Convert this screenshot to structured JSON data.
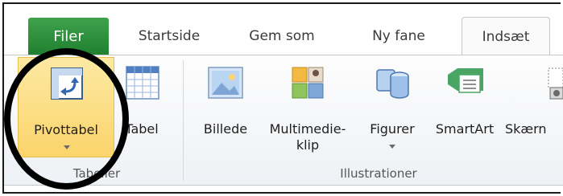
{
  "tabs": [
    {
      "label": "Filer"
    },
    {
      "label": "Startside"
    },
    {
      "label": "Gem som"
    },
    {
      "label": "Ny fane"
    },
    {
      "label": "Indsæt"
    }
  ],
  "ribbon": {
    "buttons": {
      "pivottabel": "Pivottabel",
      "tabel": "Tabel",
      "billede": "Billede",
      "multimedie_line1": "Multimedie-",
      "multimedie_line2": "klip",
      "figurer": "Figurer",
      "smartart": "SmartArt",
      "skaerm": "Skærn"
    },
    "groups": {
      "tabeller": "Tabeller",
      "illustrationer": "Illustrationer"
    }
  },
  "colors": {
    "file_tab": "#2a8a3a",
    "highlight": "#fbd46b"
  }
}
